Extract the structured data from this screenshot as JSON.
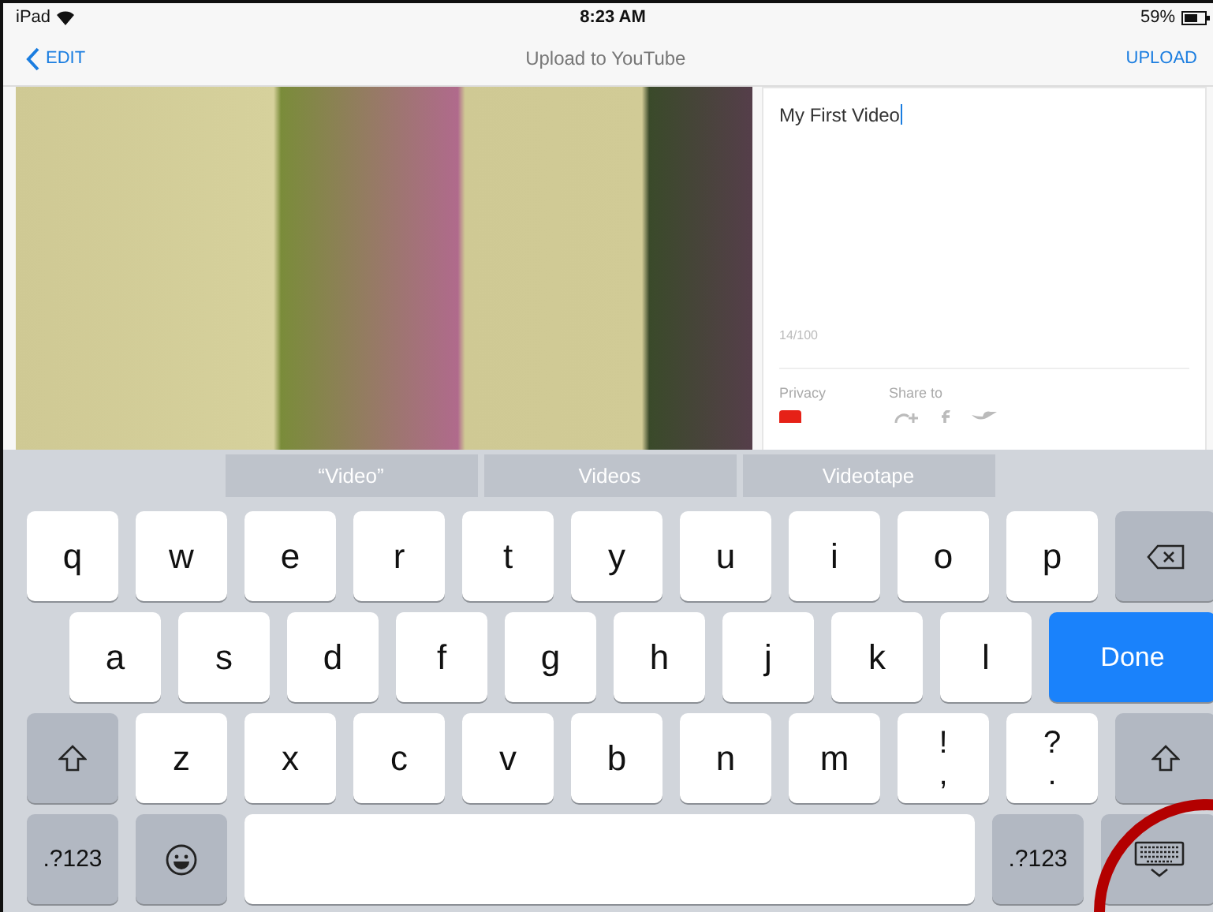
{
  "status_bar": {
    "carrier": "iPad",
    "time": "8:23 AM",
    "battery": "59%"
  },
  "nav": {
    "back": "EDIT",
    "title": "Upload to YouTube",
    "action": "UPLOAD"
  },
  "editor": {
    "title_value": "My First Video",
    "counter": "14/100",
    "privacy_label": "Privacy",
    "share_label": "Share to"
  },
  "suggestions": [
    "“Video”",
    "Videos",
    "Videotape"
  ],
  "keyboard": [
    [
      {
        "kind": "char",
        "label": "q"
      },
      {
        "kind": "char",
        "label": "w"
      },
      {
        "kind": "char",
        "label": "e"
      },
      {
        "kind": "char",
        "label": "r"
      },
      {
        "kind": "char",
        "label": "t"
      },
      {
        "kind": "char",
        "label": "y"
      },
      {
        "kind": "char",
        "label": "u"
      },
      {
        "kind": "char",
        "label": "i"
      },
      {
        "kind": "char",
        "label": "o"
      },
      {
        "kind": "char",
        "label": "p"
      },
      {
        "kind": "backspace"
      }
    ],
    [
      {
        "kind": "char",
        "label": "a"
      },
      {
        "kind": "char",
        "label": "s"
      },
      {
        "kind": "char",
        "label": "d"
      },
      {
        "kind": "char",
        "label": "f"
      },
      {
        "kind": "char",
        "label": "g"
      },
      {
        "kind": "char",
        "label": "h"
      },
      {
        "kind": "char",
        "label": "j"
      },
      {
        "kind": "char",
        "label": "k"
      },
      {
        "kind": "char",
        "label": "l"
      },
      {
        "kind": "done",
        "label": "Done"
      }
    ],
    [
      {
        "kind": "shift"
      },
      {
        "kind": "char",
        "label": "z"
      },
      {
        "kind": "char",
        "label": "x"
      },
      {
        "kind": "char",
        "label": "c"
      },
      {
        "kind": "char",
        "label": "v"
      },
      {
        "kind": "char",
        "label": "b"
      },
      {
        "kind": "char",
        "label": "n"
      },
      {
        "kind": "char",
        "label": "m"
      },
      {
        "kind": "dual",
        "label": "!",
        "sublabel": ","
      },
      {
        "kind": "dual",
        "label": "?",
        "sublabel": "."
      },
      {
        "kind": "shift"
      }
    ],
    [
      {
        "kind": "mode",
        "label": ".?123"
      },
      {
        "kind": "emoji"
      },
      {
        "kind": "space"
      },
      {
        "kind": "mode",
        "label": ".?123"
      },
      {
        "kind": "dismiss"
      }
    ]
  ]
}
